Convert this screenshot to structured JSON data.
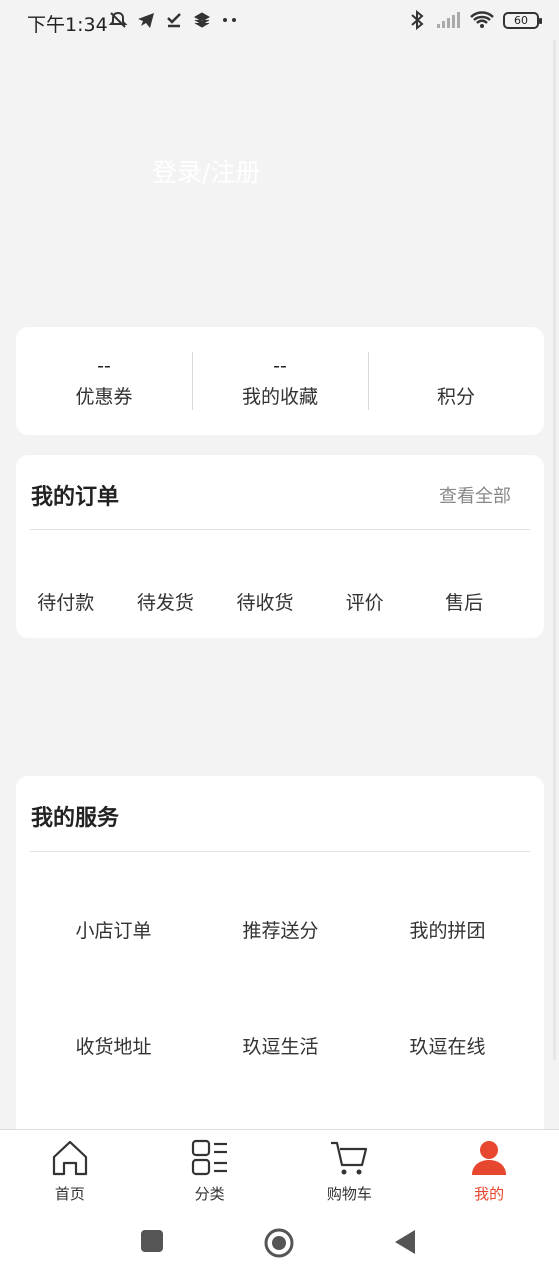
{
  "status_bar": {
    "time": "下午1:34",
    "battery": "60"
  },
  "login": {
    "label": "登录/注册"
  },
  "stats": [
    {
      "value": "--",
      "label": "优惠券"
    },
    {
      "value": "--",
      "label": "我的收藏"
    },
    {
      "value": "",
      "label": "积分"
    }
  ],
  "orders": {
    "title": "我的订单",
    "view_all": "查看全部",
    "items": [
      "待付款",
      "待发货",
      "待收货",
      "评价",
      "售后"
    ]
  },
  "services": {
    "title": "我的服务",
    "items": [
      "小店订单",
      "推荐送分",
      "我的拼团",
      "收货地址",
      "玖逗生活",
      "玖逗在线"
    ]
  },
  "tabs": [
    {
      "label": "首页",
      "icon": "home-icon"
    },
    {
      "label": "分类",
      "icon": "category-icon"
    },
    {
      "label": "购物车",
      "icon": "cart-icon"
    },
    {
      "label": "我的",
      "icon": "user-icon",
      "active": true
    }
  ],
  "colors": {
    "accent": "#e8472f",
    "background": "#f3f3f3"
  }
}
